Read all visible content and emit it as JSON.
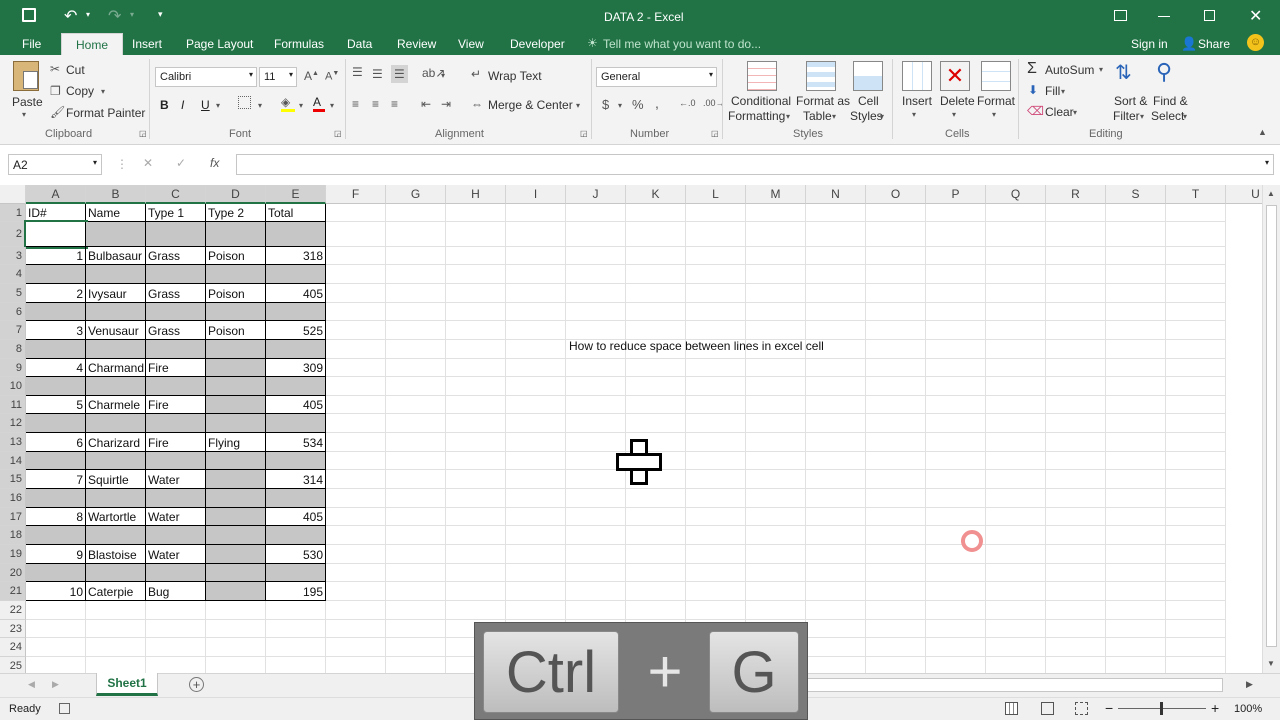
{
  "window": {
    "title": "DATA 2 - Excel"
  },
  "tabs": [
    "File",
    "Home",
    "Insert",
    "Page Layout",
    "Formulas",
    "Data",
    "Review",
    "View",
    "Developer"
  ],
  "tell_me": "Tell me what you want to do...",
  "sign_in": "Sign in",
  "share": "Share",
  "ribbon": {
    "clipboard": {
      "paste": "Paste",
      "cut": "Cut",
      "copy": "Copy",
      "format_painter": "Format Painter",
      "group": "Clipboard"
    },
    "font": {
      "name": "Calibri",
      "size": "11",
      "group": "Font"
    },
    "alignment": {
      "wrap_text": "Wrap Text",
      "merge_center": "Merge & Center",
      "group": "Alignment"
    },
    "number": {
      "format": "General",
      "group": "Number"
    },
    "styles": {
      "conditional_1": "Conditional",
      "conditional_2": "Formatting",
      "format_table_1": "Format as",
      "format_table_2": "Table",
      "cell_styles_1": "Cell",
      "cell_styles_2": "Styles",
      "group": "Styles"
    },
    "cells": {
      "insert": "Insert",
      "delete": "Delete",
      "format": "Format",
      "group": "Cells"
    },
    "editing": {
      "autosum": "AutoSum",
      "fill": "Fill",
      "clear": "Clear",
      "sort_1": "Sort &",
      "sort_2": "Filter",
      "find_1": "Find &",
      "find_2": "Select",
      "group": "Editing"
    }
  },
  "name_box": "A2",
  "formula_bar": {
    "fx": "fx",
    "value": ""
  },
  "columns": [
    "A",
    "B",
    "C",
    "D",
    "E",
    "F",
    "G",
    "H",
    "I",
    "J",
    "K",
    "L",
    "M",
    "N",
    "O",
    "P",
    "Q",
    "R",
    "S",
    "T",
    "U"
  ],
  "rows": [
    "1",
    "2",
    "3",
    "4",
    "5",
    "6",
    "7",
    "8",
    "9",
    "10",
    "11",
    "12",
    "13",
    "14",
    "15",
    "16",
    "17",
    "18",
    "19",
    "20",
    "21",
    "22",
    "23",
    "24",
    "25"
  ],
  "table": {
    "headers": [
      "ID#",
      "Name",
      "Type 1",
      "Type 2",
      "Total"
    ],
    "records": [
      [
        "1",
        "Bulbasaur",
        "Grass",
        "Poison",
        "318"
      ],
      [
        "2",
        "Ivysaur",
        "Grass",
        "Poison",
        "405"
      ],
      [
        "3",
        "Venusaur",
        "Grass",
        "Poison",
        "525"
      ],
      [
        "4",
        "Charmand",
        "Fire",
        "",
        "309"
      ],
      [
        "5",
        "Charmele",
        "Fire",
        "",
        "405"
      ],
      [
        "6",
        "Charizard",
        "Fire",
        "Flying",
        "534"
      ],
      [
        "7",
        "Squirtle",
        "Water",
        "",
        "314"
      ],
      [
        "8",
        "Wartortle",
        "Water",
        "",
        "405"
      ],
      [
        "9",
        "Blastoise",
        "Water",
        "",
        "530"
      ],
      [
        "10",
        "Caterpie",
        "Bug",
        "",
        "195"
      ]
    ]
  },
  "annotation": "How to reduce space between lines in excel cell",
  "sheet_tab": "Sheet1",
  "status": {
    "ready": "Ready",
    "zoom": "100%"
  },
  "shortcut": {
    "key1": "Ctrl",
    "plus": "+",
    "key2": "G"
  },
  "colors": {
    "excel_green": "#217346",
    "gray_fill": "#c6c6c6"
  }
}
